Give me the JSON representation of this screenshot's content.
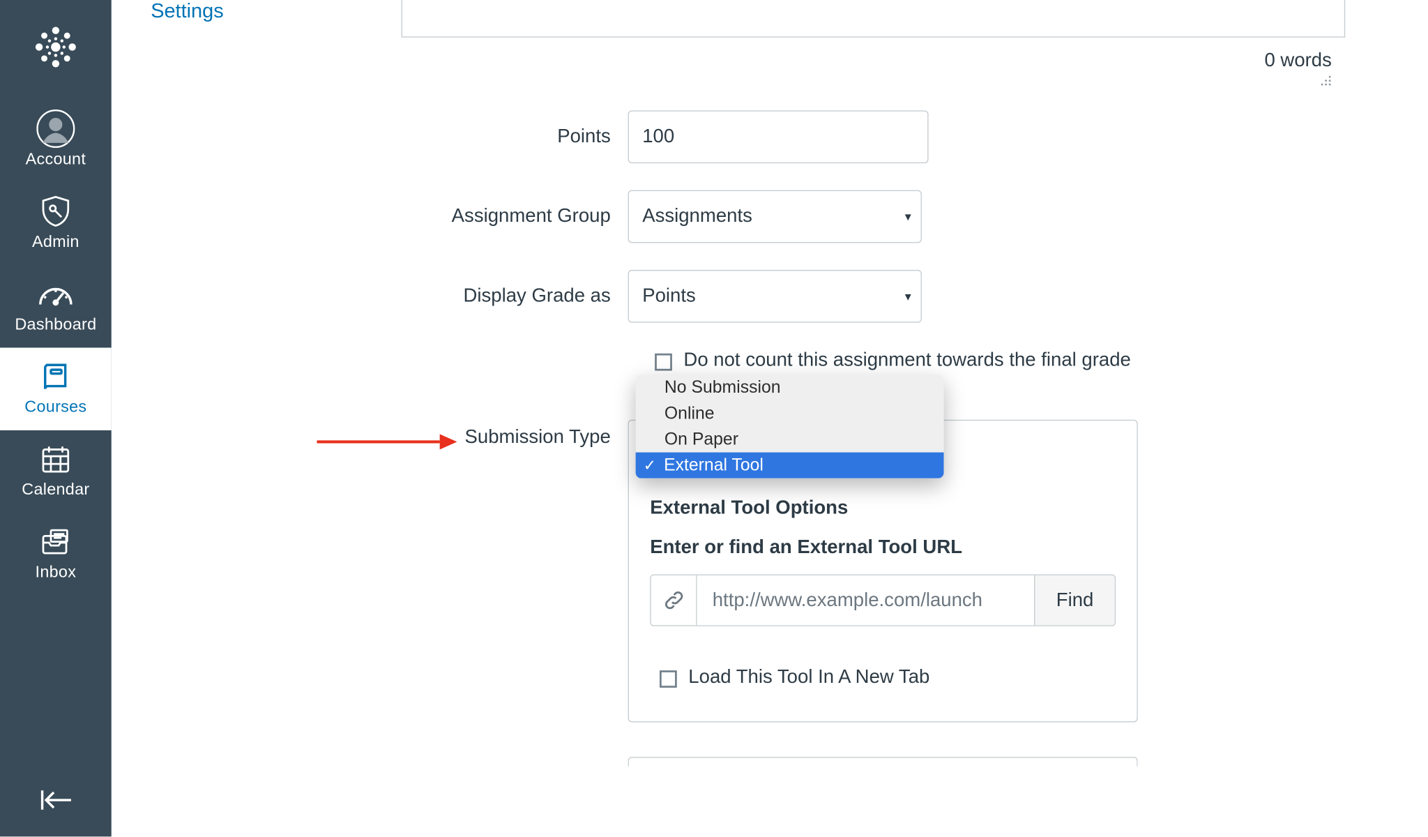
{
  "nav": {
    "items": [
      {
        "label": "Account"
      },
      {
        "label": "Admin"
      },
      {
        "label": "Dashboard"
      },
      {
        "label": "Courses"
      },
      {
        "label": "Calendar"
      },
      {
        "label": "Inbox"
      }
    ]
  },
  "course_nav_link": "Settings",
  "word_count": "0 words",
  "form": {
    "points_label": "Points",
    "points_value": "100",
    "group_label": "Assignment Group",
    "group_value": "Assignments",
    "grade_label": "Display Grade as",
    "grade_value": "Points",
    "no_count_label": "Do not count this assignment towards the final grade",
    "submission_label": "Submission Type"
  },
  "dropdown": {
    "options": [
      "No Submission",
      "Online",
      "On Paper",
      "External Tool"
    ],
    "selected": "External Tool"
  },
  "ext": {
    "heading": "External Tool Options",
    "sub": "Enter or find an External Tool URL",
    "placeholder": "http://www.example.com/launch",
    "find": "Find",
    "newtab": "Load This Tool In A New Tab"
  }
}
